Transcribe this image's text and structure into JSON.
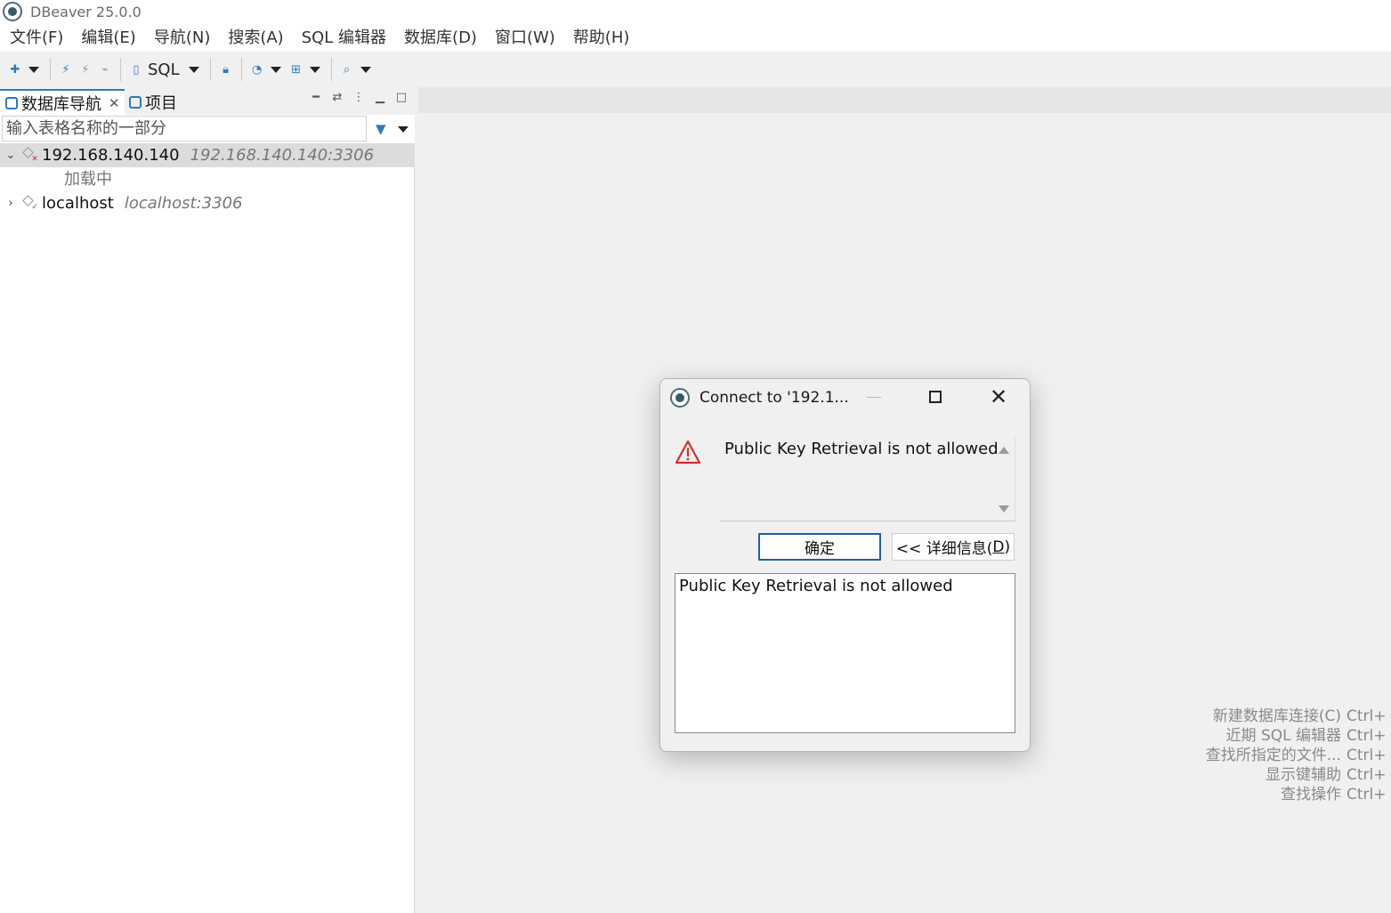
{
  "app": {
    "title": "DBeaver 25.0.0"
  },
  "menu": [
    "文件(F)",
    "编辑(E)",
    "导航(N)",
    "搜索(A)",
    "SQL 编辑器",
    "数据库(D)",
    "窗口(W)",
    "帮助(H)"
  ],
  "toolbar": {
    "sql_label": "SQL"
  },
  "navigator": {
    "tabs": [
      {
        "label": "数据库导航",
        "active": true
      },
      {
        "label": "项目",
        "active": false
      }
    ],
    "search_placeholder": "输入表格名称的一部分",
    "connections": [
      {
        "name": "192.168.140.140",
        "address": "192.168.140.140:3306",
        "expanded": true,
        "status": "error",
        "child": "加载中"
      },
      {
        "name": "localhost",
        "address": "localhost:3306",
        "expanded": false,
        "status": "ok"
      }
    ]
  },
  "shortcuts": [
    {
      "label": "新建数据库连接(C)",
      "key": "Ctrl+"
    },
    {
      "label": "近期 SQL 编辑器",
      "key": "Ctrl+"
    },
    {
      "label": "查找所指定的文件...",
      "key": "Ctrl+"
    },
    {
      "label": "显示键辅助",
      "key": "Ctrl+"
    },
    {
      "label": "查找操作",
      "key": "Ctrl+"
    }
  ],
  "dialog": {
    "title": "Connect to '192.1...",
    "message": "Public Key Retrieval is not allowed",
    "ok_label": "确定",
    "details_prefix": "<< 详细信息(",
    "details_mnemonic": "D",
    "details_suffix": ")",
    "details_text": "Public Key Retrieval is not allowed"
  },
  "colors": {
    "accent": "#2e7bbd",
    "error": "#d32f2f",
    "ok": "#2e8b3d",
    "warning": "#d32f2f"
  }
}
